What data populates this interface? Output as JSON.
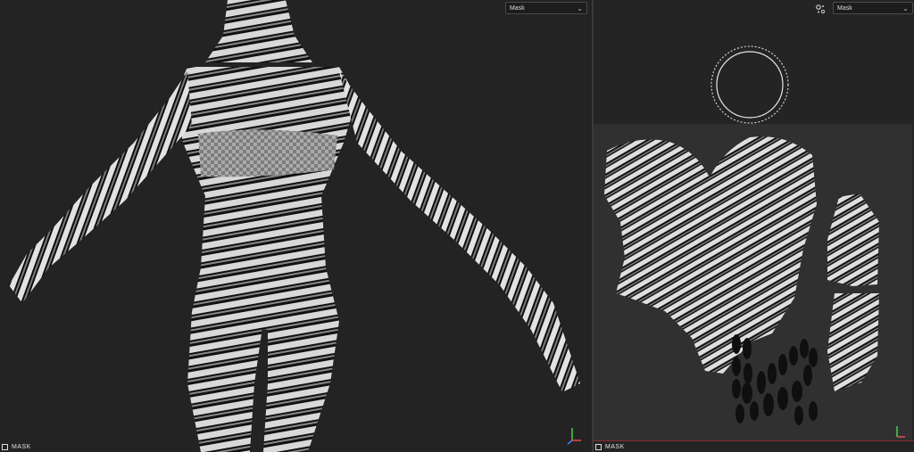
{
  "viewport3d": {
    "channel_dropdown": {
      "value": "Mask"
    },
    "status_label": "MASK"
  },
  "viewport2d": {
    "channel_dropdown": {
      "value": "Mask"
    },
    "status_label": "MASK",
    "settings_icon": "settings-gear-icon"
  },
  "colors": {
    "background": "#232323",
    "uv_canvas": "#303030",
    "accent_line": "#8a2a2a"
  }
}
